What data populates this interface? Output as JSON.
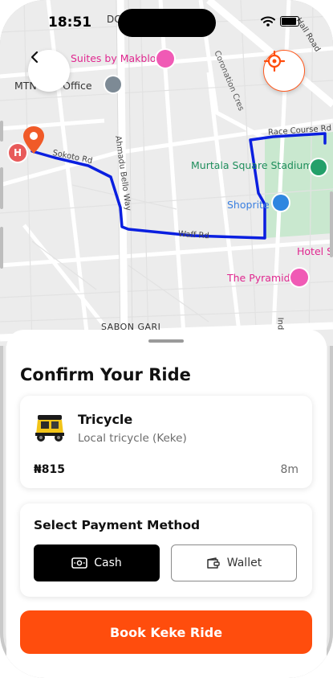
{
  "status_bar": {
    "time": "18:51",
    "carrier_fragment": "DC"
  },
  "map": {
    "places": [
      {
        "name": "Suites by Makblo",
        "kind": "hotel"
      },
      {
        "name": "MTN … d Office",
        "kind": "office"
      },
      {
        "name": "Coronation Cres",
        "kind": "street"
      },
      {
        "name": "Sokoto Rd",
        "kind": "street"
      },
      {
        "name": "Ahmadu Bello Way",
        "kind": "street"
      },
      {
        "name": "Murtala Square Stadium",
        "kind": "park"
      },
      {
        "name": "Race Course Rd",
        "kind": "street"
      },
      {
        "name": "Shoprite",
        "kind": "shopping"
      },
      {
        "name": "Waff Rd",
        "kind": "street"
      },
      {
        "name": "Hotel S",
        "kind": "hotel"
      },
      {
        "name": "The Pyramid",
        "kind": "hotel"
      },
      {
        "name": "SABON GARI",
        "kind": "area"
      },
      {
        "name": "Hall Road",
        "kind": "street"
      },
      {
        "name": "Inde",
        "kind": "street"
      }
    ],
    "route_color": "#0a1fe0",
    "pin_color": "#f05a28"
  },
  "sheet": {
    "title": "Confirm Your Ride",
    "ride": {
      "name": "Tricycle",
      "description": "Local tricycle (Keke)",
      "price": "₦815",
      "eta": "8m",
      "icon": "tricycle-image"
    },
    "payment": {
      "title": "Select Payment Method",
      "options": [
        {
          "label": "Cash",
          "icon": "cash-icon",
          "selected": true
        },
        {
          "label": "Wallet",
          "icon": "wallet-icon",
          "selected": false
        }
      ]
    },
    "book_button": "Book Keke Ride"
  },
  "colors": {
    "accent": "#ff4d0d",
    "selected_payment_bg": "#000000"
  }
}
